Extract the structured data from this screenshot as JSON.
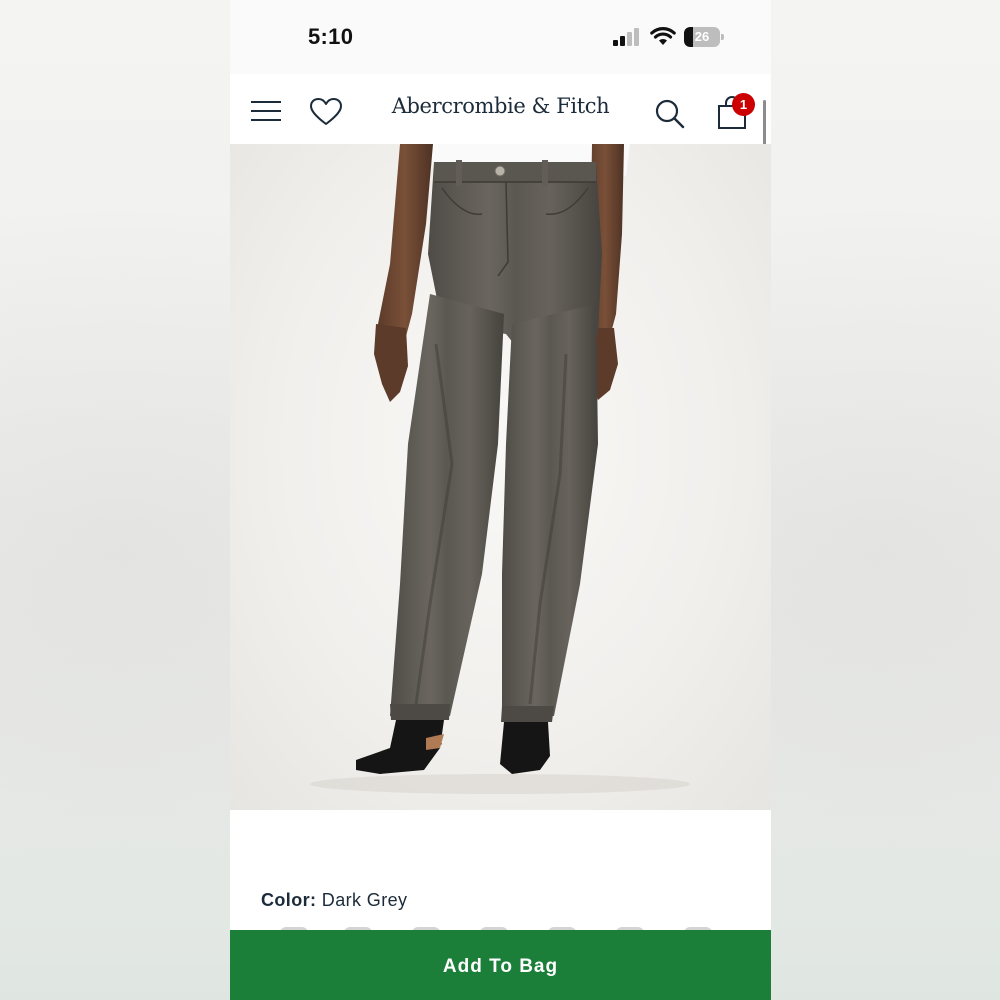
{
  "status_bar": {
    "time": "5:10",
    "battery_level": "26",
    "battery_fraction": 0.26
  },
  "header": {
    "brand": "Abercrombie & Fitch",
    "bag_count": "1",
    "icons": [
      "menu-icon",
      "heart-icon",
      "search-icon",
      "bag-icon"
    ]
  },
  "product": {
    "image_alt": "Dark grey high rise straight jeans on model",
    "color_label": "Color:",
    "color_value": "Dark Grey"
  },
  "cta": {
    "add_to_bag_label": "Add To Bag"
  },
  "colors": {
    "cta_green": "#1b7f3a",
    "badge_red": "#cc0000",
    "brand_navy": "#1c2b39"
  }
}
